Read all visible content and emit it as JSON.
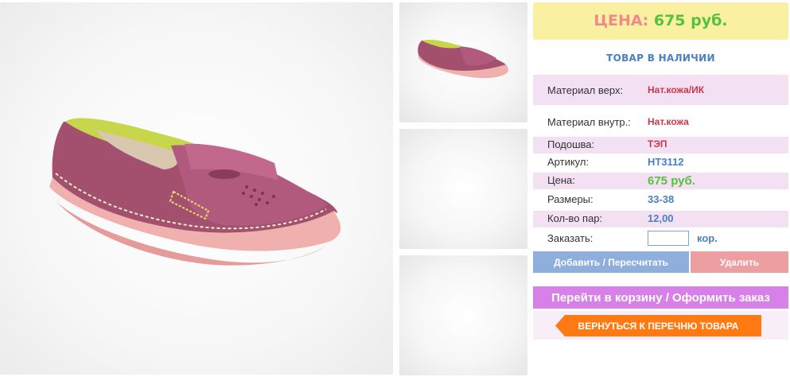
{
  "product": {
    "price_label": "ЦЕНА:",
    "price_value": "675 руб.",
    "availability": "ТОВАР В НАЛИЧИИ"
  },
  "specs": [
    {
      "label": "Материал верх:",
      "value": "Нат.кожа/ИК"
    },
    {
      "label": "Материал внутр.:",
      "value": "Нат.кожа"
    },
    {
      "label": "Подошва:",
      "value": "ТЭП"
    },
    {
      "label": "Артикул:",
      "value": "НТ3112"
    },
    {
      "label": "Цена:",
      "value": "675 руб."
    },
    {
      "label": "Размеры:",
      "value": "33-38"
    },
    {
      "label": "Кол-во пар:",
      "value": "12,00"
    }
  ],
  "order": {
    "label": "Заказать:",
    "quantity_value": "",
    "unit": "кор."
  },
  "buttons": {
    "add": "Добавить / Пересчитать",
    "delete": "Удалить",
    "cart": "Перейти в корзину / Оформить заказ",
    "back": "ВЕРНУТЬСЯ К ПЕРЕЧНЮ ТОВАРА"
  },
  "colors": {
    "shoe": "#a3506f",
    "sole": "#efb0ae",
    "price_green": "#55c13c",
    "accent_blue": "#4a7fc1",
    "accent_red": "#c8374a"
  }
}
